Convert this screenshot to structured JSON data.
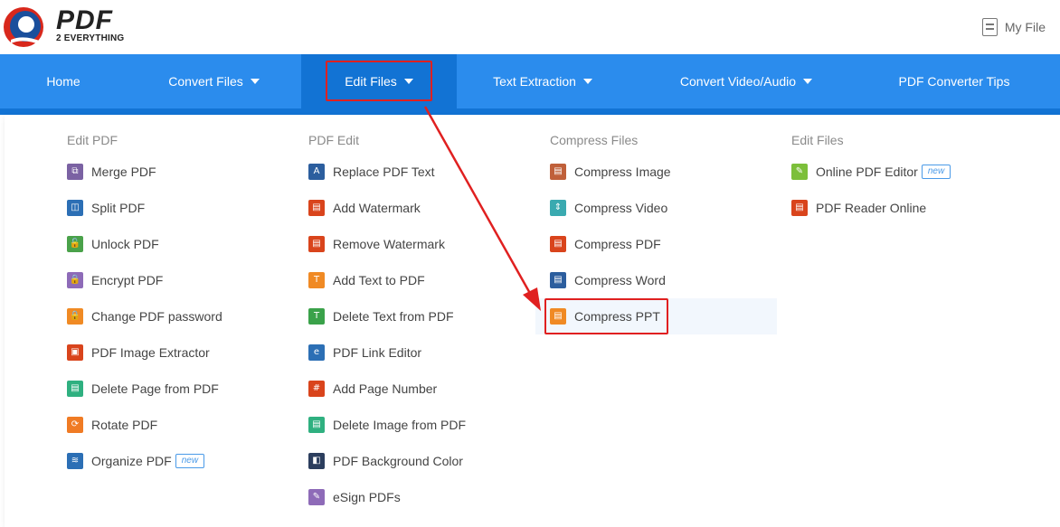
{
  "header": {
    "logo_text": "PDF",
    "logo_sub": "2 EVERYTHING",
    "my_file_label": "My File"
  },
  "nav": {
    "items": [
      {
        "label": "Home",
        "has_caret": false
      },
      {
        "label": "Convert Files",
        "has_caret": true
      },
      {
        "label": "Edit Files",
        "has_caret": true,
        "active": true
      },
      {
        "label": "Text Extraction",
        "has_caret": true
      },
      {
        "label": "Convert Video/Audio",
        "has_caret": true
      },
      {
        "label": "PDF Converter Tips",
        "has_caret": false
      }
    ]
  },
  "menu": {
    "columns": [
      {
        "title": "Edit PDF",
        "items": [
          {
            "label": "Merge PDF",
            "icon": "merge-icon",
            "color": "#7b62a3",
            "glyph": "⧉"
          },
          {
            "label": "Split PDF",
            "icon": "split-icon",
            "color": "#2c6fb5",
            "glyph": "◫"
          },
          {
            "label": "Unlock PDF",
            "icon": "unlock-icon",
            "color": "#4aa24a",
            "glyph": "🔓"
          },
          {
            "label": "Encrypt PDF",
            "icon": "lock-icon",
            "color": "#8e6bb8",
            "glyph": "🔒"
          },
          {
            "label": "Change PDF password",
            "icon": "key-lock-icon",
            "color": "#f08a24",
            "glyph": "🔒"
          },
          {
            "label": "PDF Image Extractor",
            "icon": "image-icon",
            "color": "#d9441c",
            "glyph": "▣"
          },
          {
            "label": "Delete Page from PDF",
            "icon": "delete-page-icon",
            "color": "#2fb080",
            "glyph": "▤"
          },
          {
            "label": "Rotate PDF",
            "icon": "rotate-icon",
            "color": "#f07b24",
            "glyph": "⟳"
          },
          {
            "label": "Organize PDF",
            "icon": "layers-icon",
            "color": "#2c6fb5",
            "glyph": "≋",
            "badge": "new"
          }
        ]
      },
      {
        "title": "PDF Edit",
        "items": [
          {
            "label": "Replace PDF Text",
            "icon": "replace-text-icon",
            "color": "#2c5e9e",
            "glyph": "A"
          },
          {
            "label": "Add Watermark",
            "icon": "add-watermark-icon",
            "color": "#d9441c",
            "glyph": "▤"
          },
          {
            "label": "Remove Watermark",
            "icon": "remove-watermark-icon",
            "color": "#d9441c",
            "glyph": "▤"
          },
          {
            "label": "Add Text to PDF",
            "icon": "add-text-icon",
            "color": "#f08a24",
            "glyph": "T"
          },
          {
            "label": "Delete Text from PDF",
            "icon": "delete-text-icon",
            "color": "#3aa24a",
            "glyph": "T"
          },
          {
            "label": "PDF Link Editor",
            "icon": "link-icon",
            "color": "#2c6fb5",
            "glyph": "e"
          },
          {
            "label": "Add Page Number",
            "icon": "page-number-icon",
            "color": "#d9441c",
            "glyph": "#"
          },
          {
            "label": "Delete Image from PDF",
            "icon": "delete-image-icon",
            "color": "#2fb080",
            "glyph": "▤"
          },
          {
            "label": "PDF Background Color",
            "icon": "background-color-icon",
            "color": "#2c3e5e",
            "glyph": "◧"
          },
          {
            "label": "eSign PDFs",
            "icon": "pen-icon",
            "color": "#8e6bb8",
            "glyph": "✎"
          }
        ]
      },
      {
        "title": "Compress Files",
        "items": [
          {
            "label": "Compress Image",
            "icon": "compress-image-icon",
            "color": "#c0603a",
            "glyph": "▤"
          },
          {
            "label": "Compress Video",
            "icon": "compress-video-icon",
            "color": "#3aaab0",
            "glyph": "⇕"
          },
          {
            "label": "Compress PDF",
            "icon": "compress-pdf-icon",
            "color": "#d9441c",
            "glyph": "▤"
          },
          {
            "label": "Compress Word",
            "icon": "compress-word-icon",
            "color": "#2c5e9e",
            "glyph": "▤"
          },
          {
            "label": "Compress PPT",
            "icon": "compress-ppt-icon",
            "color": "#f08a24",
            "glyph": "▤",
            "hover": true
          }
        ]
      },
      {
        "title": "Edit Files",
        "items": [
          {
            "label": "Online PDF Editor",
            "icon": "online-editor-icon",
            "color": "#7cbf3a",
            "glyph": "✎",
            "badge": "new"
          },
          {
            "label": "PDF Reader Online",
            "icon": "reader-icon",
            "color": "#d9441c",
            "glyph": "▤"
          }
        ]
      }
    ]
  },
  "colors": {
    "nav_bg": "#2b8ced",
    "nav_active": "#1273d4",
    "highlight": "#e02020",
    "hover_bg": "#f2f7fd"
  }
}
